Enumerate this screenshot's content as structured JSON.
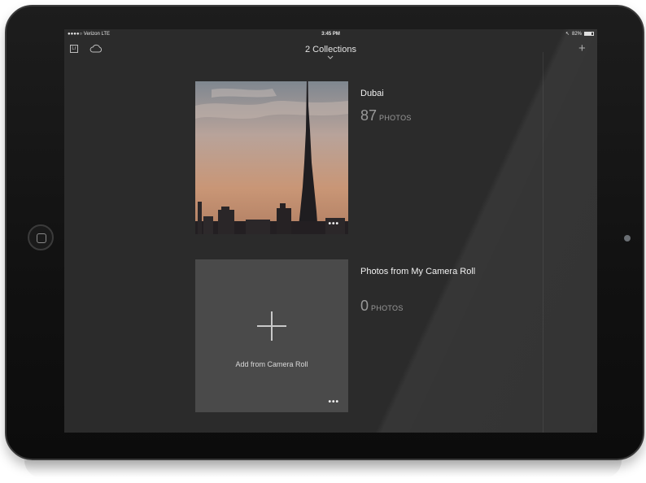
{
  "status_bar": {
    "carrier": "●●●●○ Verizon  LTE",
    "time": "3:45 PM",
    "battery": "82%"
  },
  "toolbar": {
    "title": "2 Collections"
  },
  "collections": [
    {
      "name": "Dubai",
      "count": "87",
      "unit": "PHOTOS",
      "more": "•••"
    },
    {
      "name": "Photos from My Camera Roll",
      "count": "0",
      "unit": "PHOTOS",
      "add_label": "Add from Camera Roll",
      "more": "•••"
    }
  ],
  "icons": {
    "app": "lightroom-icon",
    "cloud": "cloud-icon",
    "add": "plus-icon",
    "more": "more-dots-icon",
    "chevron": "chevron-down-icon"
  },
  "colors": {
    "screen_bg": "#2b2b2b",
    "placeholder_bg": "#4a4a4a",
    "text_primary": "#f2f2f2",
    "text_secondary": "#9a9a9a"
  }
}
